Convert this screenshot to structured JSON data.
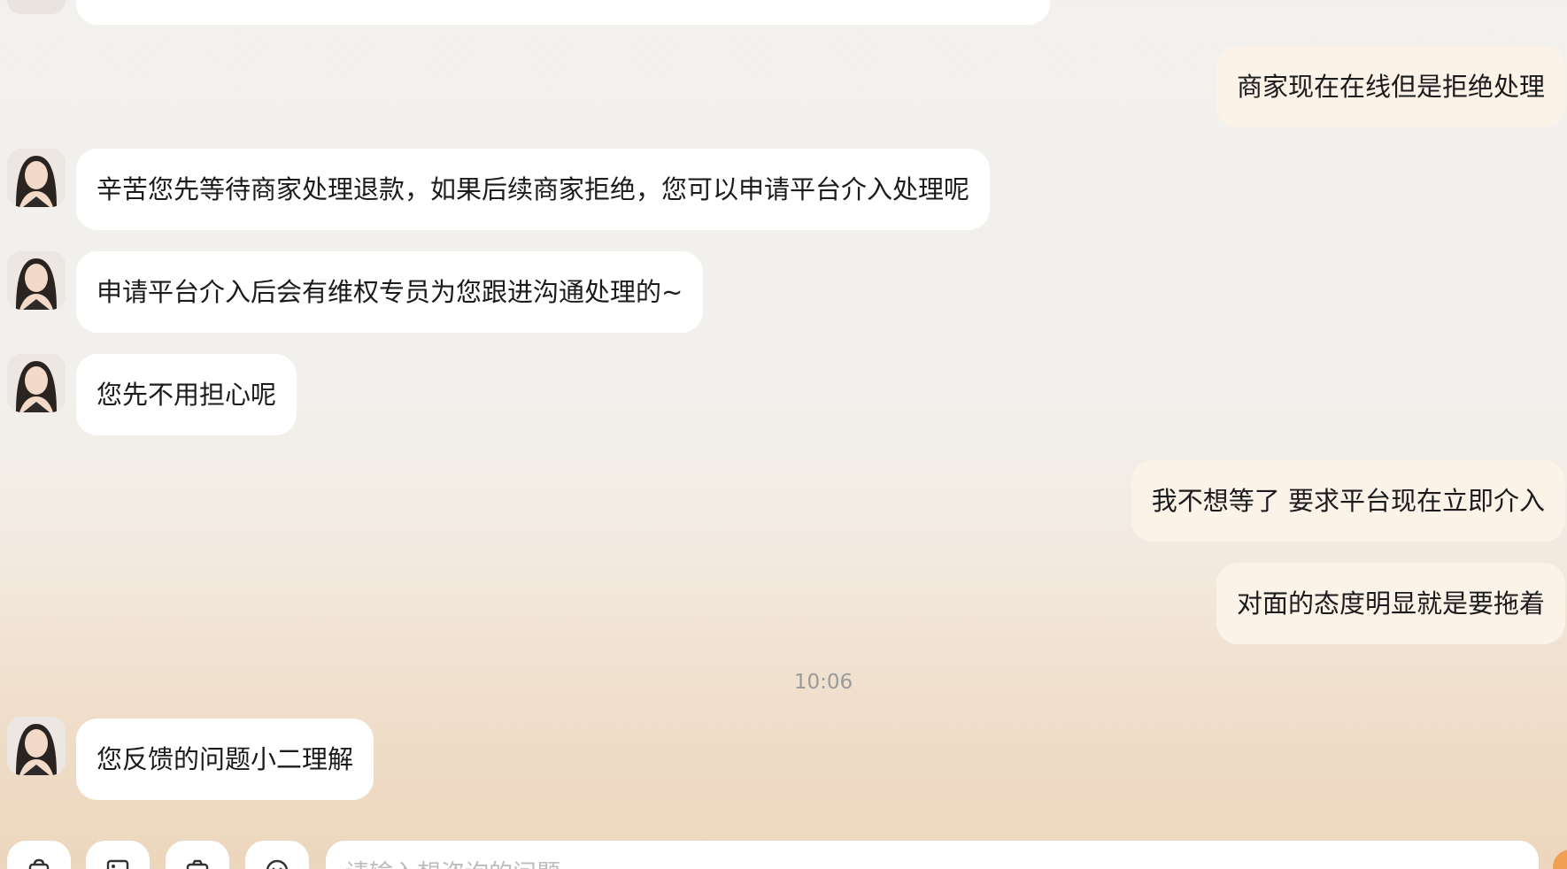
{
  "messages": [
    {
      "from": "user",
      "text": "商家现在在线但是拒绝处理"
    },
    {
      "from": "agent",
      "text": "辛苦您先等待商家处理退款，如果后续商家拒绝，您可以申请平台介入处理呢"
    },
    {
      "from": "agent",
      "text": "申请平台介入后会有维权专员为您跟进沟通处理的~"
    },
    {
      "from": "agent",
      "text": "您先不用担心呢"
    },
    {
      "from": "user",
      "text": "我不想等了 要求平台现在立即介入"
    },
    {
      "from": "user",
      "text": "对面的态度明显就是要拖着"
    },
    {
      "from": "agent",
      "text": "您反馈的问题小二理解"
    }
  ],
  "timestamp": "10:06",
  "input": {
    "placeholder": "请输入想咨询的问题",
    "value": ""
  },
  "toolbar": {
    "icons": [
      "order-icon",
      "image-icon",
      "camera-icon",
      "emoji-icon"
    ]
  },
  "colors": {
    "agent_bubble": "#ffffff",
    "user_bubble": "#fbf2e8",
    "accent": "#f0a050"
  }
}
